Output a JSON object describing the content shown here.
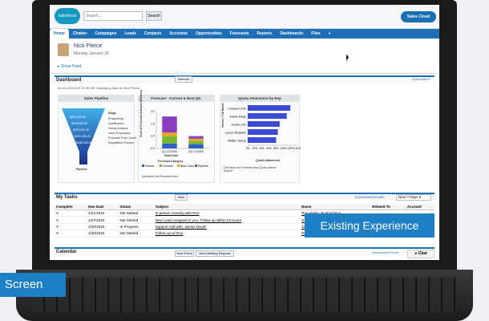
{
  "overlays": {
    "experience": "Existing Experience",
    "screen": "Screen"
  },
  "header": {
    "logo": "salesforce",
    "search_placeholder": "Search...",
    "search_button": "Search",
    "app": "Sales Cloud"
  },
  "tabs": [
    "Home",
    "Chatter",
    "Campaigns",
    "Leads",
    "Contacts",
    "Accounts",
    "Opportunities",
    "Forecasts",
    "Reports",
    "Dashboards",
    "Files",
    "+"
  ],
  "profile": {
    "name": "Nick Pierce",
    "date": "Monday January 26",
    "show_feed": "Show Feed"
  },
  "dashboard": {
    "title": "Dashboard",
    "refresh": "Refresh",
    "customize": "Customize P",
    "as_of": "As of 1/22/2015 10:48 AM. Displaying data as Nick Pierce."
  },
  "colors": {
    "accent": "#1e6fb6",
    "overlay": "#1d7fc4",
    "funnel_top": "#3fb0e8",
    "funnel_bottom": "#1a2f8a",
    "bar": "#3b4bd4"
  },
  "pipeline_panel": {
    "title": "Sales Pipeline",
    "legend_title": "Stage",
    "labels": [
      "$369,630.00",
      "$315,900.00",
      "$220,000.00",
      "$203,150.00",
      "$156,200.00"
    ],
    "stages": [
      "Prospecting",
      "Qualification",
      "Needs Analysis",
      "Value Proposition",
      "Proposal/ Price Quote",
      "Negotiation/ Review"
    ],
    "caption": "Pipeline"
  },
  "forecast_panel": {
    "title": "Forecast - Current & Next Qtr.",
    "ylabel": "Sum of Forecast Amount (Millions)",
    "xlabel": "Start Date",
    "legend_title": "Forecast Category",
    "caption": "Drill down for Forecast View"
  },
  "quota_panel": {
    "title": "Quota Attainment by Rep",
    "ylabel": "Owner: Full Name",
    "xlabel": "Quota Attainment",
    "caption": "Drill down for Forecast and Quota Joined Report"
  },
  "chart_data": [
    {
      "type": "bar",
      "title": "Forecast - Current & Next Qtr.",
      "categories": [
        "Q1 CY2015",
        "Q2 CY2015"
      ],
      "series": [
        {
          "name": "Closed",
          "color": "#2e5fc7",
          "values": [
            0.4,
            0.35
          ]
        },
        {
          "name": "Commit",
          "color": "#74b82f",
          "values": [
            0.6,
            0.25
          ]
        },
        {
          "name": "Best Case",
          "color": "#f0a020",
          "values": [
            0.3,
            0.2
          ]
        },
        {
          "name": "Pipeline",
          "color": "#8a3fbf",
          "values": [
            1.3,
            0.2
          ]
        }
      ],
      "xlabel": "Start Date",
      "ylabel": "Sum of Forecast Amount (Millions)",
      "ylim": [
        0,
        3
      ],
      "yticks": [
        "0.0",
        "1.0",
        "2.0",
        "3.0"
      ]
    },
    {
      "type": "bar",
      "orientation": "horizontal",
      "title": "Quota Attainment by Rep",
      "categories": [
        "Clarissa Chan",
        "Elaine Diego",
        "Kenan Lam",
        "Lauren Bingham",
        "William Sylvas"
      ],
      "values": [
        120,
        110,
        90,
        85,
        80
      ],
      "xlim": [
        0,
        140
      ],
      "xticks": [
        "0%",
        "20%",
        "40%",
        "60%",
        "80%",
        "100%",
        "120%",
        "140%"
      ],
      "xlabel": "Quota Attainment",
      "ylabel": "Owner: Full Name"
    }
  ],
  "tasks": {
    "title": "My Tasks",
    "new": "New",
    "unresolved": "Unresolved Emails",
    "range": "Next 7 Days",
    "columns": [
      "Complete",
      "Due Date",
      "Status",
      "Subject",
      "Name",
      "Related To",
      "Account"
    ],
    "rows": [
      [
        "X",
        "1/21/2015",
        "Not Started",
        "In person meeting with Ron",
        "Ron Abelin, Boxford Pon",
        "",
        ""
      ],
      [
        "X",
        "1/27/2015",
        "Not Started",
        "New Lead Assigned to you. Follow up within 24 Hours",
        "S Hartman, Green Dot M",
        "",
        ""
      ],
      [
        "X",
        "1/30/2015",
        "In Progress",
        "Support Call with: James Devie*",
        "James Wu",
        "",
        ""
      ],
      [
        "X",
        "1/30/2015",
        "Not Started",
        "Follow up w/ Ron",
        "Ron Abelin, Boxford Pon",
        "",
        ""
      ]
    ]
  },
  "calendar": {
    "title": "Calendar",
    "new_event": "New Event",
    "new_meeting": "New Meeting Request",
    "unresolved": "Unresolved Events",
    "chat": "Chat"
  }
}
